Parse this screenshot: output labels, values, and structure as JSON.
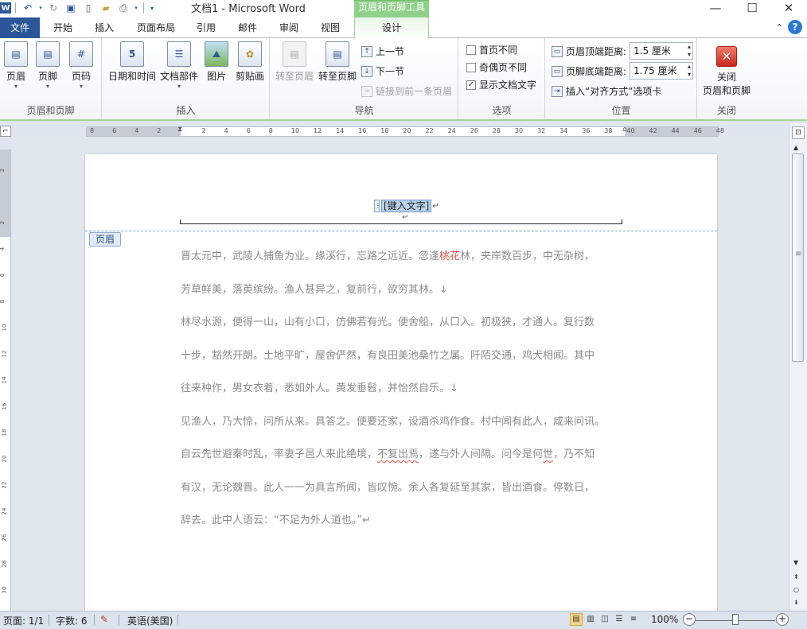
{
  "window": {
    "title": "文档1  -  Microsoft Word",
    "context_tab_title": "页眉和页脚工具",
    "controls": [
      "minimize-icon",
      "maximize-icon",
      "close-icon"
    ]
  },
  "ribbon_tabs": [
    "文件",
    "开始",
    "插入",
    "页面布局",
    "引用",
    "邮件",
    "审阅",
    "视图",
    "设计"
  ],
  "ribbon": {
    "groups": {
      "hf": {
        "label": "页眉和页脚",
        "header": "页眉",
        "footer": "页脚",
        "page_number": "页码"
      },
      "insert": {
        "label": "插入",
        "datetime": "日期和时间",
        "docparts": "文档部件",
        "picture": "图片",
        "clipart": "剪贴画"
      },
      "nav": {
        "label": "导航",
        "goto_header": "转至页眉",
        "goto_footer": "转至页脚",
        "prev": "上一节",
        "next": "下一节",
        "link_prev": "链接到前一条页眉"
      },
      "options": {
        "label": "选项",
        "first_page": "首页不同",
        "odd_even": "奇偶页不同",
        "show_text": "显示文档文字",
        "show_text_checked": "✓"
      },
      "position": {
        "label": "位置",
        "header_top": "页眉顶端距离:",
        "header_top_value": "1.5 厘米",
        "footer_bottom": "页脚底端距离:",
        "footer_bottom_value": "1.75 厘米",
        "insert_align": "插入“对齐方式”选项卡"
      },
      "close": {
        "label": "关闭",
        "close_btn_line1": "关闭",
        "close_btn_line2": "页眉和页脚"
      }
    }
  },
  "ruler": {
    "h_ticks": [
      "8",
      "6",
      "4",
      "2",
      "",
      "2",
      "4",
      "6",
      "8",
      "10",
      "12",
      "14",
      "16",
      "18",
      "20",
      "22",
      "24",
      "26",
      "28",
      "30",
      "32",
      "34",
      "36",
      "38",
      "40",
      "42",
      "44",
      "46",
      "48"
    ],
    "v_ticks": [
      "2",
      "",
      "2",
      "4",
      "6",
      "8",
      "10",
      "12",
      "14",
      "16",
      "18",
      "20",
      "22",
      "24",
      "26",
      "28",
      "30",
      "32"
    ]
  },
  "document": {
    "header_placeholder": "[键入文字]",
    "header_tag": "页眉",
    "paragraphs": [
      {
        "pre": "晋太元中，武陵人捕鱼为业。缘溪行，忘路之远近。忽逢",
        "red": "桃花",
        "post": "林，夹岸数百步，中无杂树，"
      },
      {
        "pre": "芳草鲜美，落英缤纷。渔人甚异之，复前行，欲穷其林。↓",
        "red": "",
        "post": ""
      },
      {
        "pre": "林尽水源，便得一山，山有小口，仿佛若有光。便舍船，从口入。初极狭，才通人。复行数",
        "red": "",
        "post": ""
      },
      {
        "pre": "十步，豁然开朗。土地平旷，屋舍俨然，有良田美池桑竹之属。阡陌交通，鸡犬相闻。其中",
        "red": "",
        "post": ""
      },
      {
        "pre": "往来种作，男女衣着，悉如外人。黄发垂髫，并怡然自乐。↓",
        "red": "",
        "post": ""
      },
      {
        "pre": "见渔人，乃大惊，问所从来。具答之。便要还家，设酒杀鸡作食。村中闻有此人，咸来问讯。",
        "red": "",
        "post": ""
      },
      {
        "pre": "自云先世避秦时乱，率妻子邑人来此绝境，",
        "squig1": "不复出焉",
        "mid": "，遂与外人间隔。问今是何",
        "squig2": "世",
        "post": "，乃不知"
      },
      {
        "pre": "有汉，无论魏晋。此人一一为具言所闻，皆叹惋。余人各复延至其家，皆出酒食。停数日，",
        "red": "",
        "post": ""
      },
      {
        "pre": "辞去。此中人语云：“不足为外人道也。”↵",
        "red": "",
        "post": ""
      }
    ]
  },
  "status_bar": {
    "page": "页面: 1/1",
    "words": "字数: 6",
    "language": "英语(美国)",
    "zoom": "100%"
  },
  "colors": {
    "file_tab": "#2b579a",
    "context_tab": "#8fd18a",
    "highlight_red": "#e2554c"
  }
}
